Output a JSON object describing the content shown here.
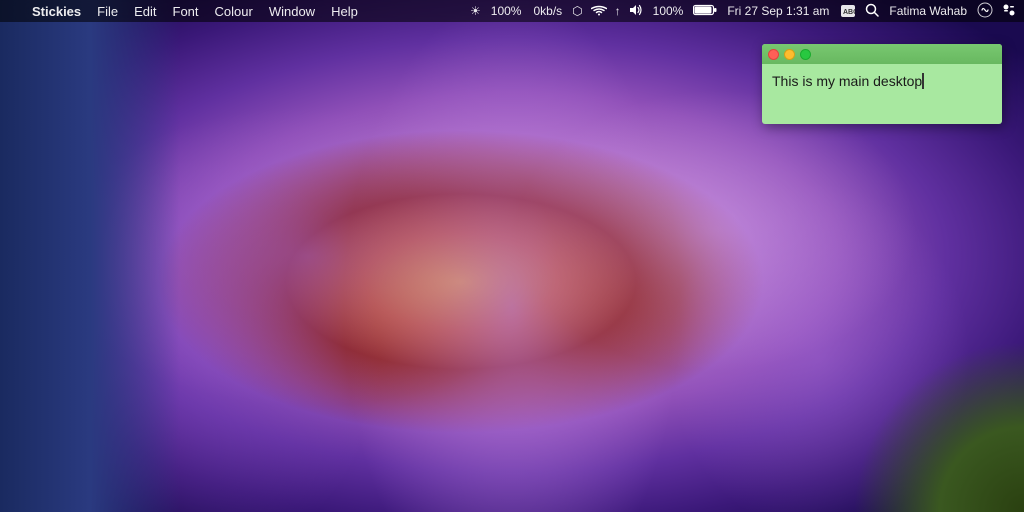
{
  "menubar": {
    "apple_symbol": "",
    "app_name": "Stickies",
    "menus": [
      "File",
      "Edit",
      "Font",
      "Colour",
      "Window",
      "Help"
    ],
    "right_items": {
      "brightness_icon": "☀",
      "brightness_pct": "100%",
      "network_up": "▲",
      "network_speed": "0kb/s",
      "bluetooth_icon": "⬡",
      "wifi_icon": "◈",
      "upload_icon": "↑",
      "volume_icon": "◀)",
      "battery_pct": "100%",
      "battery_icon": "🔋",
      "date_time": "Fri 27 Sep  1:31 am",
      "abc_label": "ABC",
      "spotlight_icon": "⌕",
      "siri_icon": "◎",
      "user_name": "Fatima Wahab",
      "control_center_icon": "⊞"
    }
  },
  "sticky": {
    "title": "",
    "content": "This is my main desktop",
    "buttons": {
      "close": "close",
      "minimize": "minimize",
      "maximize": "maximize"
    }
  }
}
